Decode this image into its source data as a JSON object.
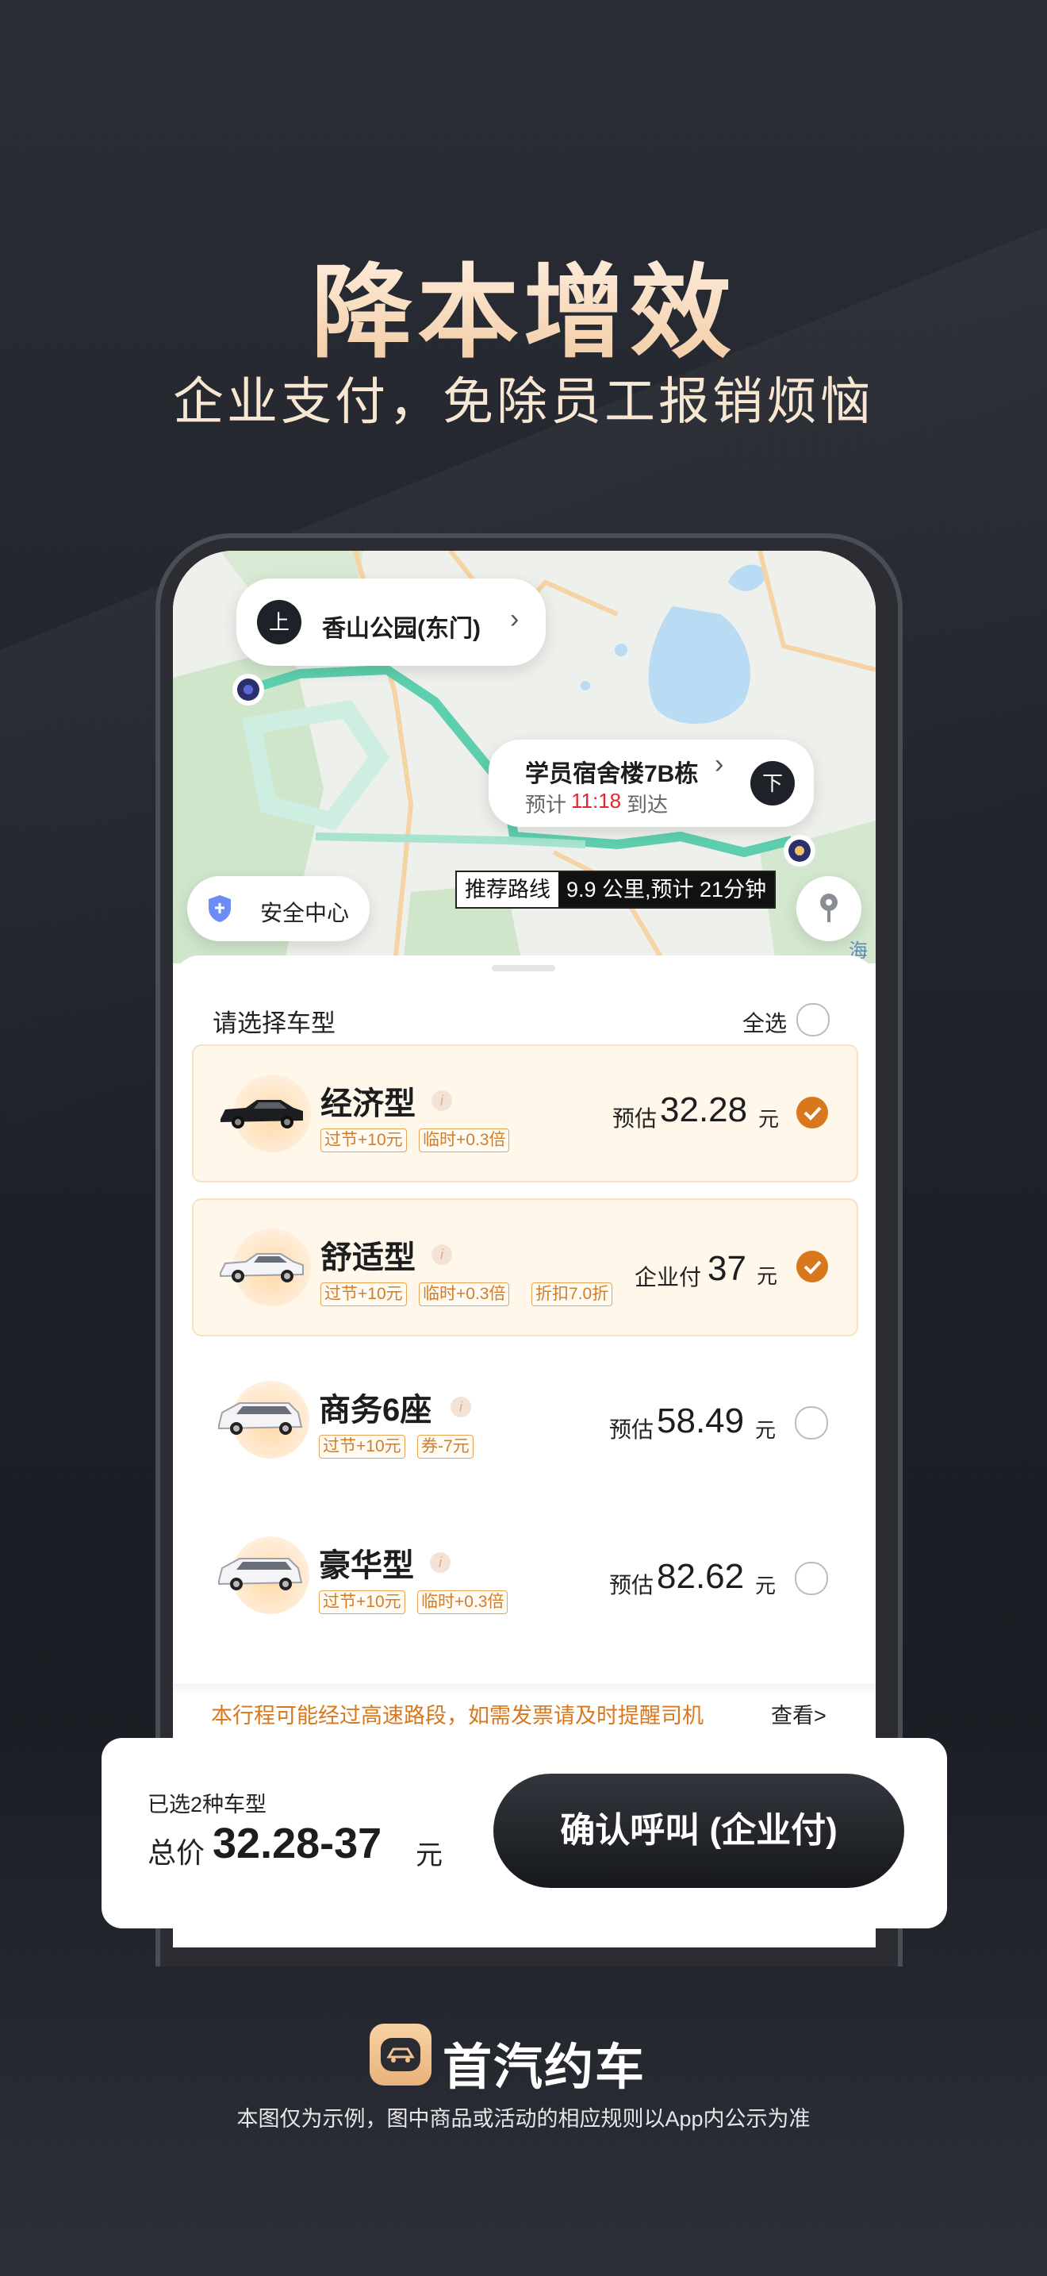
{
  "headline": "降本增效",
  "subheadline": "企业支付，免除员工报销烦恼",
  "map": {
    "pickup_badge": "上",
    "pickup_name": "香山公园(东门)",
    "pickup_chevron": "›",
    "dropoff_badge": "下",
    "dropoff_name": "学员宿舍楼7B栋",
    "dropoff_chevron": "›",
    "eta_prefix": "预计",
    "eta_time": "11:18",
    "eta_suffix": "到达",
    "route_label": "推荐路线",
    "route_info": "9.9 公里,预计 21分钟",
    "safety_center": "安全中心",
    "map_text_fragment": "海",
    "route_color": "#5ecfae"
  },
  "sheet": {
    "title": "请选择车型",
    "select_all": "全选",
    "notice": "本行程可能经过高速路段，如需发票请及时提醒司机",
    "notice_link": "查看>",
    "cars": [
      {
        "name": "经济型",
        "tags": [
          "过节+10元",
          "临时+0.3倍"
        ],
        "price_label": "预估",
        "price": "32.28",
        "unit": "元",
        "selected": true,
        "icon": "black-sedan-icon"
      },
      {
        "name": "舒适型",
        "tags": [
          "过节+10元",
          "临时+0.3倍",
          "折扣7.0折"
        ],
        "price_label": "企业付",
        "price": "37",
        "unit": "元",
        "selected": true,
        "icon": "white-sedan-icon"
      },
      {
        "name": "商务6座",
        "tags": [
          "过节+10元",
          "券-7元"
        ],
        "price_label": "预估",
        "price": "58.49",
        "unit": "元",
        "selected": false,
        "icon": "white-mpv-icon"
      },
      {
        "name": "豪华型",
        "tags": [
          "过节+10元",
          "临时+0.3倍"
        ],
        "price_label": "预估",
        "price": "82.62",
        "unit": "元",
        "selected": false,
        "icon": "white-mpv-icon"
      }
    ],
    "info_glyph": "i"
  },
  "bottom": {
    "selected_count": "已选2种车型",
    "total_label": "总价",
    "total_range": "32.28-37",
    "total_unit": "元",
    "confirm_label": "确认呼叫 (企业付)"
  },
  "brand": {
    "name": "首汽约车",
    "disclaimer": "本图仅为示例，图中商品或活动的相应规则以App内公示为准",
    "accent": "#f3c38f"
  },
  "colors": {
    "accent_orange": "#d9771c",
    "eta_red": "#e2262b"
  }
}
